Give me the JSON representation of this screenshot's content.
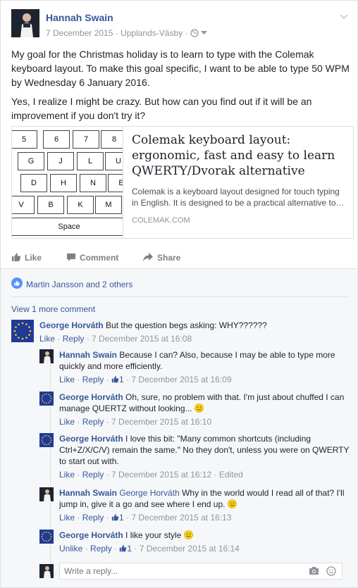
{
  "post": {
    "author": "Hannah Swain",
    "date": "7 December 2015",
    "location": "Upplands-Väsby",
    "separator": "·",
    "text_p1": "My goal for the Christmas holiday is to learn to type with the Colemak keyboard layout. To make this goal specific, I want to be able to type 50 WPM by Wednesday 6 January 2016.",
    "text_p2": "Yes, I realize I might be crazy. But how can you find out if it will be an improvement if you don't try it?"
  },
  "link_card": {
    "title": "Colemak keyboard layout: ergonomic, fast and easy to learn QWERTY/Dvorak alternative",
    "description": "Colemak is a keyboard layout designed for touch typing in English. It is designed to be a practical alternative to…",
    "domain": "COLEMAK.COM",
    "keyboard": {
      "row1": [
        "5",
        "6",
        "7",
        "8"
      ],
      "row2": [
        "G",
        "J",
        "L",
        "U"
      ],
      "row3": [
        "D",
        "H",
        "N",
        "E"
      ],
      "row4": [
        "V",
        "B",
        "K",
        "M"
      ],
      "space": "Space"
    }
  },
  "actions": {
    "like": "Like",
    "comment": "Comment",
    "share": "Share"
  },
  "likes": {
    "text": "Martin Jansson and 2 others"
  },
  "view_more": "View 1 more comment",
  "comments": [
    {
      "author": "George Horváth",
      "text": "But the question begs asking: WHY??????",
      "like": "Like",
      "reply": "Reply",
      "time": "7 December 2015 at 16:08"
    }
  ],
  "replies": [
    {
      "author": "Hannah Swain",
      "text": "Because I can? Also, because I may be able to type more quickly and more efficiently.",
      "like": "Like",
      "reply": "Reply",
      "like_count": "1",
      "time": "7 December 2015 at 16:09"
    },
    {
      "author": "George Horváth",
      "text": "Oh, sure, no problem with that. I'm just about chuffed I can manage QUERTZ without looking...",
      "like": "Like",
      "reply": "Reply",
      "time": "7 December 2015 at 16:10"
    },
    {
      "author": "George Horváth",
      "text": "I love this bit: \"Many common shortcuts (including Ctrl+Z/X/C/V) remain the same.\" No they don't, unless you were on QWERTY to start out with.",
      "like": "Like",
      "reply": "Reply",
      "time": "7 December 2015 at 16:12",
      "edited": "Edited"
    },
    {
      "author": "Hannah Swain",
      "tag": "George Horváth",
      "text": "Why in the world would I read all of that? I'll jump in, give it a go and see where I end up.",
      "like": "Like",
      "reply": "Reply",
      "like_count": "1",
      "time": "7 December 2015 at 16:13"
    },
    {
      "author": "George Horváth",
      "text": "I like your style",
      "like": "Unlike",
      "reply": "Reply",
      "like_count": "1",
      "time": "7 December 2015 at 16:14"
    }
  ],
  "reply_box": {
    "placeholder": "Write a reply..."
  },
  "colors": {
    "link": "#365899",
    "meta": "#90949c",
    "eu_blue": "#203a9a",
    "star": "#f7d117"
  }
}
